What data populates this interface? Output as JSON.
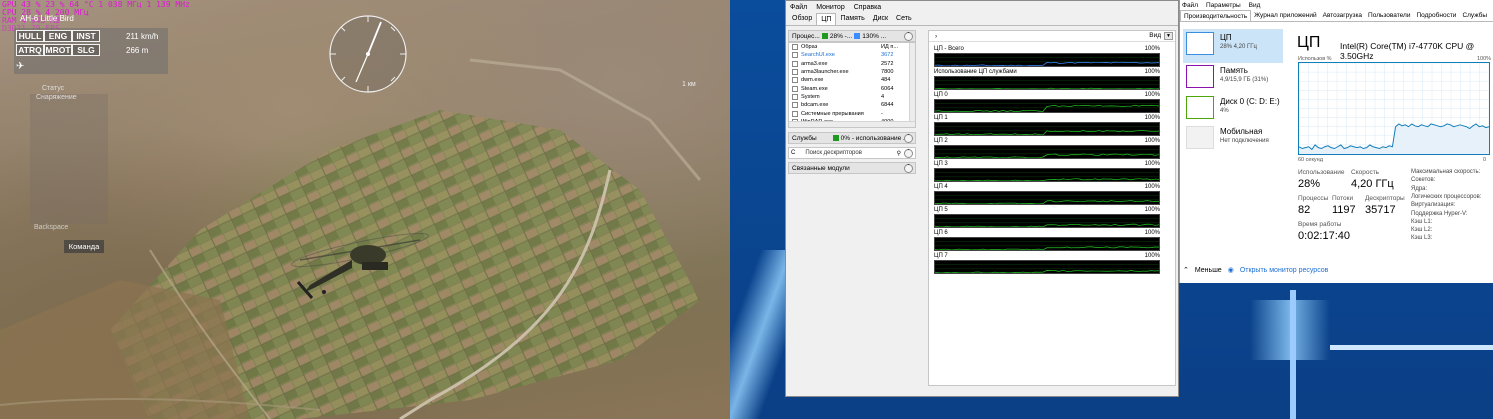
{
  "game": {
    "osd_lines": [
      "GPU     43 % 23 % 64 °C   1 038 МГц 1 139 MHz",
      "CPU     28 % 4 200 МГц",
      "RAM     4 943 MB",
      "D3D11   79 FPS",
      "Frametime 12 ms"
    ],
    "vehicle_name": "AH-6 Little Bird",
    "hud_buttons": [
      "HULL",
      "ENG",
      "INST",
      "ATRQ",
      "MROT",
      "SLG"
    ],
    "speed": "211 km/h",
    "altitude": "266 m",
    "side_items": [
      "Статус",
      "Снаряжение"
    ],
    "backspace_label": "Backspace",
    "command_label": "Команда",
    "distance_label": "1 км"
  },
  "procexp": {
    "menu": [
      "Файл",
      "Монитор",
      "Справка"
    ],
    "tabs": [
      "Обзор",
      "ЦП",
      "Память",
      "Диск",
      "Сеть"
    ],
    "active_tab": 1,
    "processes_header": "Процес...",
    "processes_cpu": "28% -...",
    "processes_max": "130% ...",
    "columns": {
      "name": "Образ",
      "pid": "ИД п..."
    },
    "processes": [
      {
        "name": "SearchUI.exe",
        "pid": "3672",
        "blue": true
      },
      {
        "name": "arma3.exe",
        "pid": "2572"
      },
      {
        "name": "arma3launcher.exe",
        "pid": "7800"
      },
      {
        "name": "dwm.exe",
        "pid": "484"
      },
      {
        "name": "Steam.exe",
        "pid": "6064"
      },
      {
        "name": "System",
        "pid": "4"
      },
      {
        "name": "bdcam.exe",
        "pid": "6844"
      },
      {
        "name": "Системные прерывания",
        "pid": "-"
      },
      {
        "name": "WinRAR.exe",
        "pid": "4000"
      }
    ],
    "services_header": "Службы",
    "services_usage": "0% - использование ...",
    "search_prefix": "С",
    "search_placeholder": "Поиск дескрипторов",
    "modules_header": "Связанные модули",
    "view_label": "Вид",
    "graphs": [
      {
        "name": "ЦП - Всего",
        "max": "100%",
        "level": 0.3
      },
      {
        "name": "Использование ЦП службами",
        "max": "100%",
        "level": 0.02
      },
      {
        "name": "ЦП 0",
        "max": "100%",
        "level": 0.55
      },
      {
        "name": "ЦП 1",
        "max": "100%",
        "level": 0.35
      },
      {
        "name": "ЦП 2",
        "max": "100%",
        "level": 0.3
      },
      {
        "name": "ЦП 3",
        "max": "100%",
        "level": 0.15
      },
      {
        "name": "ЦП 4",
        "max": "100%",
        "level": 0.25
      },
      {
        "name": "ЦП 5",
        "max": "100%",
        "level": 0.2
      },
      {
        "name": "ЦП 6",
        "max": "100%",
        "level": 0.25
      },
      {
        "name": "ЦП 7",
        "max": "100%",
        "level": 0.2
      }
    ],
    "colors": {
      "graph_line": "#22c322",
      "graph_bg": "#000000",
      "total_line": "#3a8cff"
    }
  },
  "taskmgr": {
    "menu": [
      "Файл",
      "Параметры",
      "Вид"
    ],
    "tabs": [
      "Производительность",
      "Журнал приложений",
      "Автозагрузка",
      "Пользователи",
      "Подробности",
      "Службы"
    ],
    "items": [
      {
        "title": "ЦП",
        "sub": "28% 4,20 ГГц",
        "color": "#3b8ee0"
      },
      {
        "title": "Память",
        "sub": "4,9/15,9 ГБ (31%)",
        "color": "#8b12ae"
      },
      {
        "title": "Диск 0 (C: D: E:)",
        "sub": "4%",
        "color": "#4da60c"
      },
      {
        "title": "Мобильная",
        "sub": "Нет подключения",
        "color": "#cccccc"
      }
    ],
    "cpu_title": "ЦП",
    "cpu_model": "Intel(R) Core(TM) i7-4770K CPU @ 3.50GHz",
    "util_label": "Использов % ",
    "pct_label": "100%",
    "seconds_label": "60 секунд",
    "zero_label": "0",
    "stats": [
      {
        "label": "Использование",
        "value": "28%"
      },
      {
        "label": "Скорость",
        "value": "4,20 ГГц"
      },
      {
        "label": "Процессы",
        "value": "82"
      },
      {
        "label": "Потоки",
        "value": "1197"
      },
      {
        "label": "Дескрипторы",
        "value": "35717"
      },
      {
        "label": "Время работы",
        "value": "0:02:17:40"
      }
    ],
    "specs": [
      "Максимальная скорость:",
      "Сокетов:",
      "Ядра:",
      "Логических процессоров:",
      "Виртуализация:",
      "Поддержка Hyper-V:",
      "Кэш L1:",
      "Кэш L2:",
      "Кэш L3:"
    ],
    "less_label": "Меньше",
    "resmon_label": "Открыть монитор ресурсов",
    "cpu_history": [
      0.08,
      0.06,
      0.07,
      0.08,
      0.05,
      0.1,
      0.07,
      0.06,
      0.08,
      0.09,
      0.07,
      0.06,
      0.08,
      0.1,
      0.06,
      0.07,
      0.09,
      0.08,
      0.07,
      0.08,
      0.06,
      0.07,
      0.1,
      0.08,
      0.07,
      0.06,
      0.08,
      0.07,
      0.09,
      0.08,
      0.3,
      0.33,
      0.31,
      0.32,
      0.3,
      0.33,
      0.31,
      0.3,
      0.32,
      0.31,
      0.3,
      0.33,
      0.32,
      0.31,
      0.3,
      0.31,
      0.33,
      0.32,
      0.3,
      0.31,
      0.32,
      0.31,
      0.3,
      0.28,
      0.31,
      0.33,
      0.3,
      0.31,
      0.29,
      0.3
    ]
  }
}
